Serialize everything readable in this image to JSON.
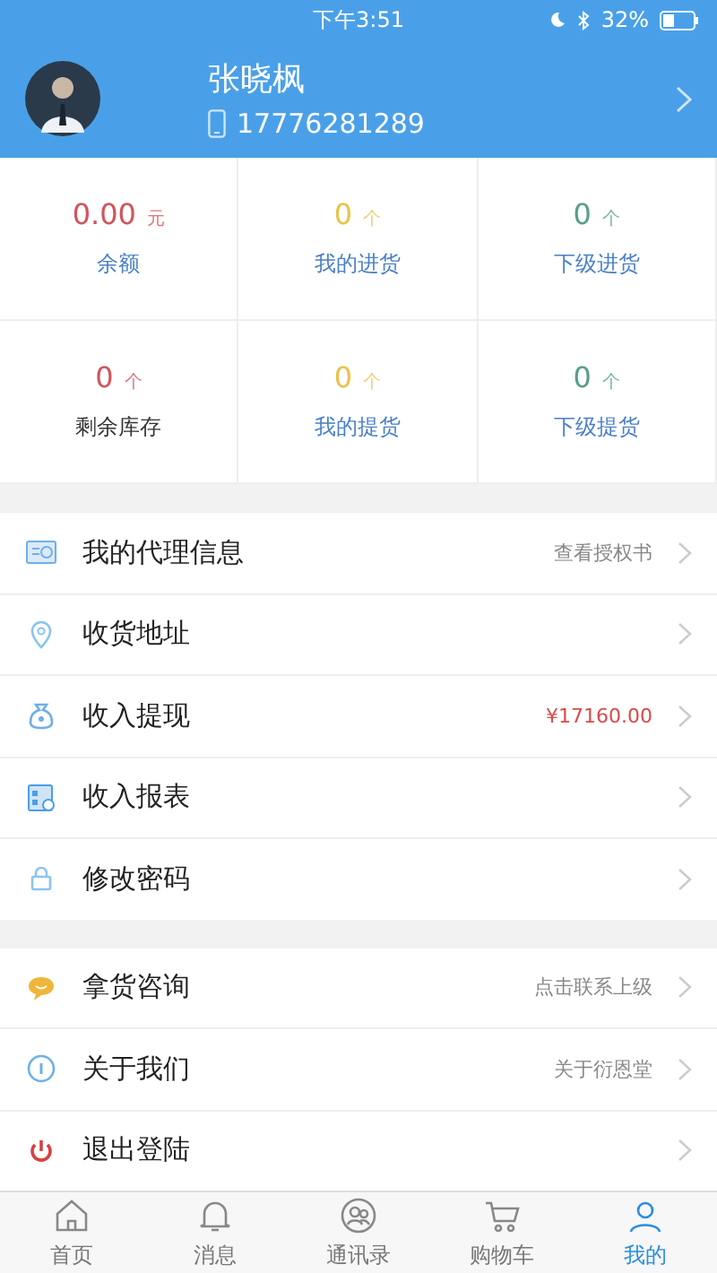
{
  "status_bar": {
    "time": "下午3:51",
    "battery": "32%"
  },
  "profile": {
    "name": "张晓枫",
    "phone": "17776281289"
  },
  "stats": [
    {
      "kind": "link",
      "value": "0.00",
      "unit": "元",
      "label": "余额",
      "color": "#d0565c"
    },
    {
      "kind": "link",
      "value": "0",
      "unit": "个",
      "label": "我的进货",
      "color": "#e8c44a"
    },
    {
      "kind": "link",
      "value": "0",
      "unit": "个",
      "label": "下级进货",
      "color": "#5a9e8c"
    },
    {
      "kind": "plain",
      "value": "0",
      "unit": "个",
      "label": "剩余库存",
      "color": "#d0565c"
    },
    {
      "kind": "link",
      "value": "0",
      "unit": "个",
      "label": "我的提货",
      "color": "#e8c44a"
    },
    {
      "kind": "link",
      "value": "0",
      "unit": "个",
      "label": "下级提货",
      "color": "#5a9e8c"
    }
  ],
  "menu_groups": [
    [
      {
        "kind": "card",
        "label": "我的代理信息",
        "detail": "查看授权书",
        "color": "#888888"
      },
      {
        "kind": "location",
        "label": "收货地址"
      },
      {
        "kind": "moneybag",
        "label": "收入提现",
        "detail": "¥17160.00",
        "color": "#d84a4a"
      },
      {
        "kind": "report",
        "label": "收入报表"
      },
      {
        "kind": "lock",
        "label": "修改密码"
      }
    ],
    [
      {
        "kind": "chat",
        "label": "拿货咨询",
        "detail": "点击联系上级",
        "color": "#888888"
      },
      {
        "kind": "info",
        "label": "关于我们",
        "detail": "关于衍恩堂",
        "color": "#888888"
      },
      {
        "kind": "power",
        "label": "退出登陆"
      }
    ]
  ],
  "tab_bar": [
    {
      "kind": "home",
      "label": "首页",
      "selected": false
    },
    {
      "kind": "bell",
      "label": "消息",
      "selected": false
    },
    {
      "kind": "contacts",
      "label": "通讯录",
      "selected": false
    },
    {
      "kind": "cart",
      "label": "购物车",
      "selected": false
    },
    {
      "kind": "user",
      "label": "我的",
      "selected": true
    }
  ]
}
